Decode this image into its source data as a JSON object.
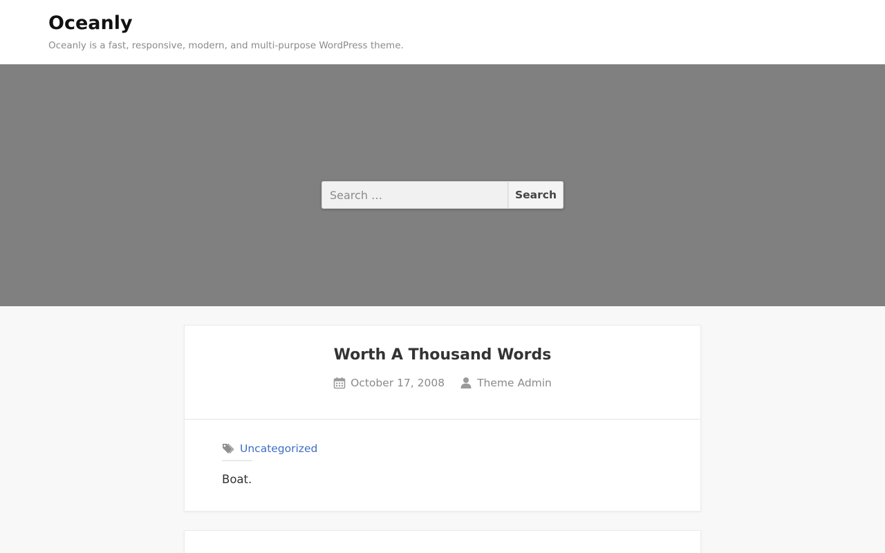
{
  "site": {
    "title": "Oceanly",
    "tagline": "Oceanly is a fast, responsive, modern, and multi-purpose WordPress theme."
  },
  "search": {
    "placeholder": "Search …",
    "button_label": "Search"
  },
  "posts": [
    {
      "title": "Worth A Thousand Words",
      "date": "October 17, 2008",
      "author": "Theme Admin",
      "category": "Uncategorized",
      "excerpt": "Boat."
    }
  ],
  "icons": {
    "date": "calendar-icon",
    "author": "user-icon",
    "category": "tags-icon"
  },
  "colors": {
    "hero_background": "#808080",
    "link": "#3b6ec4",
    "page_background": "#f8f8f8",
    "card_background": "#ffffff"
  }
}
